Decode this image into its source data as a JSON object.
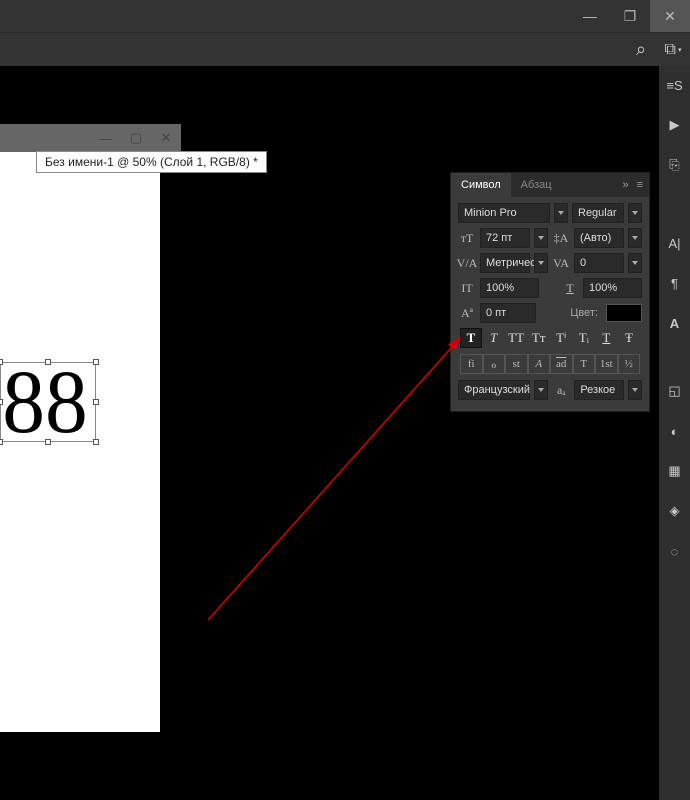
{
  "titlebar": {
    "min": "—",
    "max": "❐",
    "close": "✕"
  },
  "topbar": {
    "search_icon": "⌕",
    "workspace_icon": "⧉"
  },
  "doc": {
    "tooltip": "Без имени-1 @ 50% (Слой 1, RGB/8) *",
    "min": "—",
    "max": "▢",
    "close": "✕",
    "text_content": "88"
  },
  "char_panel": {
    "tabs": {
      "symbol": "Символ",
      "paragraph": "Абзац"
    },
    "collapse": "»",
    "menu": "≡",
    "font_family": "Minion Pro",
    "font_style": "Regular",
    "size_icon": "тТ",
    "size_value": "72 пт",
    "leading_icon": "‡A",
    "leading_value": "(Авто)",
    "kerning_icon": "V/A",
    "kerning_value": "Метрическ",
    "tracking_icon": "VA",
    "tracking_value": "0",
    "vscale_icon": "IT",
    "vscale_value": "100%",
    "hscale_icon": "T",
    "hscale_value": "100%",
    "baseline_icon": "Aª",
    "baseline_value": "0 пт",
    "color_label": "Цвет:",
    "styles": {
      "faux_bold": "T",
      "faux_italic": "T",
      "all_caps": "TT",
      "small_caps": "Tᴛ",
      "superscript": "Tⁱ",
      "subscript": "Tᵢ",
      "underline": "T",
      "strike": "Ŧ"
    },
    "opentype": {
      "liga": "fi",
      "calt": "ℴ",
      "dlig": "st",
      "swsh": "A",
      "salt": "ad",
      "titl": "T",
      "ordn": "1st",
      "frac": "½"
    },
    "language": "Французский",
    "aa_icon": "aₐ",
    "antialiasing": "Резкое"
  },
  "rail": {
    "styles": "≡S",
    "play": "▶",
    "libraries": "⎘",
    "char": "A|",
    "para": "¶",
    "glyph": "A",
    "cube": "◱",
    "ball": "◐",
    "swatches": "▦",
    "layers": "◈",
    "cc": "◌"
  }
}
